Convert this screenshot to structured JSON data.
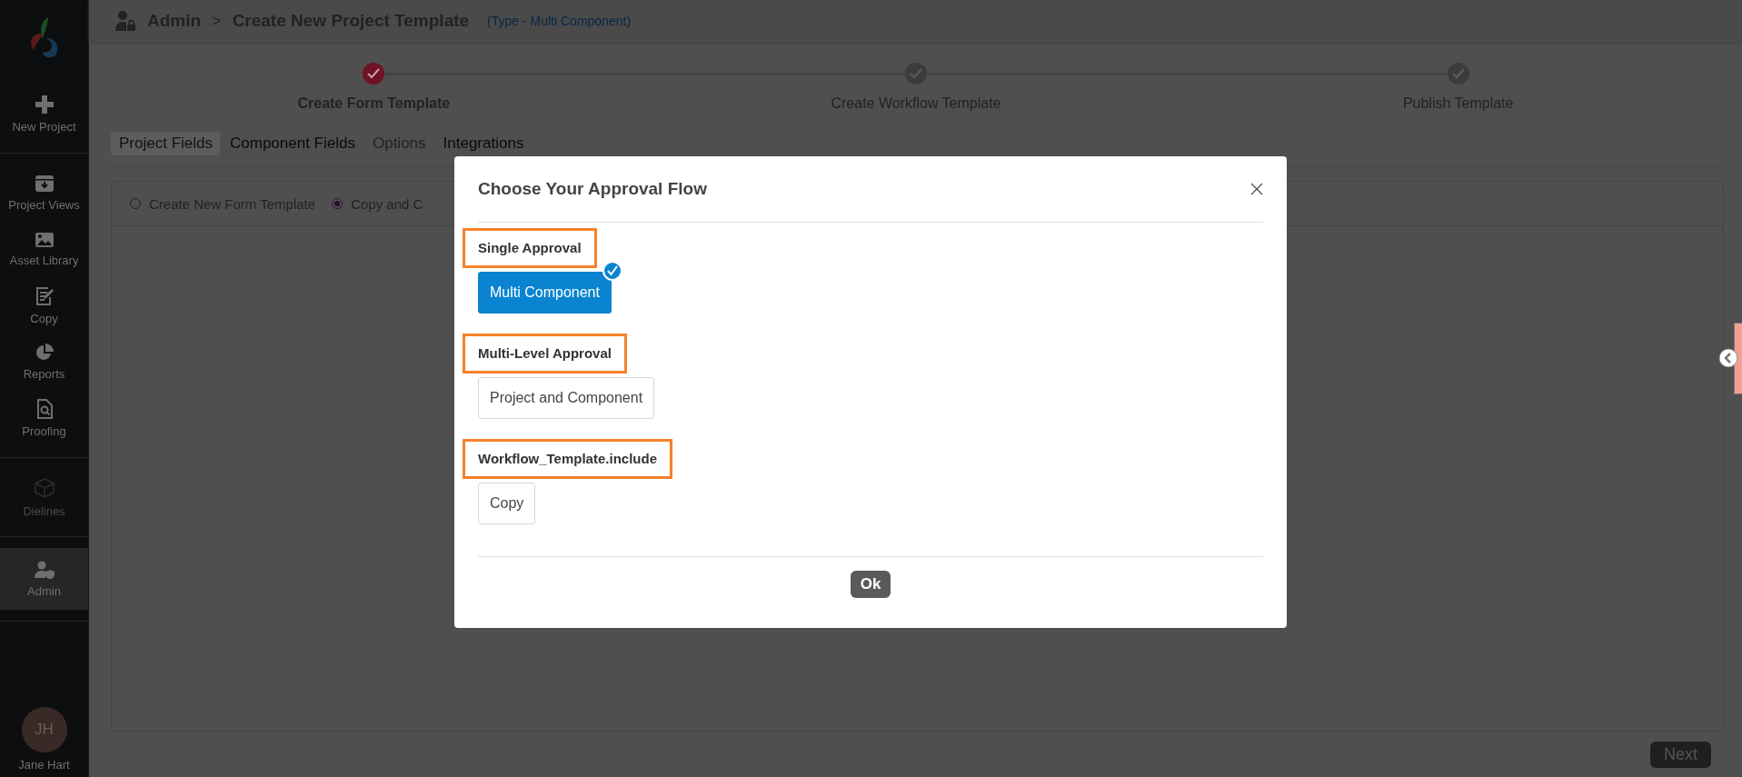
{
  "sidebar": {
    "sections": [
      [
        {
          "label": "New Project",
          "selected": false,
          "disabled": false
        }
      ],
      [
        {
          "label": "Project Views",
          "selected": false,
          "disabled": false
        },
        {
          "label": "Asset Library",
          "selected": false,
          "disabled": false
        },
        {
          "label": "Copy",
          "selected": false,
          "disabled": false
        },
        {
          "label": "Reports",
          "selected": false,
          "disabled": false
        },
        {
          "label": "Proofing",
          "selected": false,
          "disabled": false
        }
      ],
      [
        {
          "label": "Dielines",
          "selected": false,
          "disabled": true
        }
      ],
      [
        {
          "label": "Admin",
          "selected": true,
          "disabled": false
        }
      ]
    ],
    "user": {
      "initials": "JH",
      "name": "Jane Hart"
    }
  },
  "header": {
    "section": "Admin",
    "separator": ">",
    "title": "Create New Project Template",
    "subtitle": "(Type - Multi Component)"
  },
  "steps": [
    {
      "label": "Create Form Template",
      "selected": true
    },
    {
      "label": "Create Workflow Template",
      "selected": false
    },
    {
      "label": "Publish Template",
      "selected": false
    }
  ],
  "tabs": [
    {
      "label": "Project Fields",
      "selected": true,
      "disabled": false
    },
    {
      "label": "Component Fields",
      "selected": false,
      "disabled": false
    },
    {
      "label": "Options",
      "selected": false,
      "disabled": true
    },
    {
      "label": "Integrations",
      "selected": false,
      "disabled": false
    }
  ],
  "form_source": [
    {
      "label": "Create New Form Template",
      "selected": false
    },
    {
      "label": "Copy and C",
      "selected": true
    }
  ],
  "next_button": "Next",
  "dialog": {
    "title": "Choose Your Approval Flow",
    "groups": [
      {
        "label": "Single Approval",
        "highlighted": true,
        "options": [
          {
            "label": "Multi Component",
            "selected": true
          }
        ]
      },
      {
        "label": "Multi-Level Approval",
        "highlighted": true,
        "options": [
          {
            "label": "Project and Component",
            "selected": false
          }
        ]
      },
      {
        "label": "Workflow_Template.include",
        "highlighted": true,
        "options": [
          {
            "label": "Copy",
            "selected": false
          }
        ]
      }
    ],
    "ok_button": "Ok"
  }
}
